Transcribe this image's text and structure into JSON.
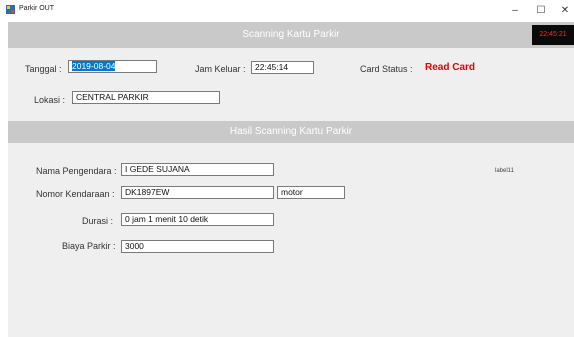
{
  "window": {
    "title": "Parkir OUT",
    "minimize": "–",
    "maximize": "☐",
    "close": "✕",
    "icon": "app-icon"
  },
  "header": {
    "banner": "Scanning Kartu Parkir",
    "clock": "22:45:21",
    "clock_color": "#ff2a2a"
  },
  "scan": {
    "tanggal_label": "Tanggal :",
    "tanggal_value": "2019-08-04",
    "jam_label": "Jam Keluar :",
    "jam_value": "22:45:14",
    "status_label": "Card Status :",
    "status_value": "Read Card",
    "status_color": "#e60000",
    "lokasi_label": "Lokasi :",
    "lokasi_value": "CENTRAL PARKIR"
  },
  "result": {
    "banner": "Hasil Scanning Kartu Parkir",
    "nama_label": "Nama Pengendara :",
    "nama_value": "I GEDE SUJANA",
    "nomor_label": "Nomor Kendaraan :",
    "nomor_value": "DK1897EW",
    "jenis_value": "motor",
    "durasi_label": "Durasi :",
    "durasi_value": "0 jam 1 menit 10 detik",
    "biaya_label": "Biaya Parkir :",
    "biaya_value": "3000",
    "extra_label": "label11"
  }
}
